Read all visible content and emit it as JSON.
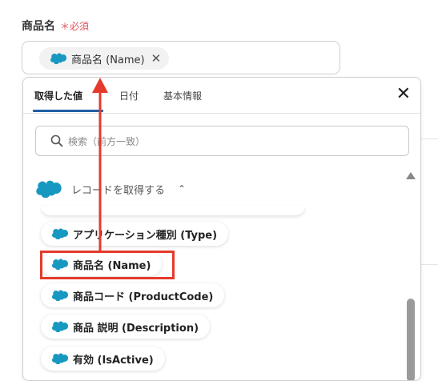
{
  "field": {
    "label": "商品名",
    "required": "＊必須",
    "chip_label": "商品名 (Name)",
    "chip_close": "✕"
  },
  "panel": {
    "tabs": [
      {
        "label": "取得した値",
        "active": true
      },
      {
        "label": "日付",
        "active": false
      },
      {
        "label": "基本情報",
        "active": false
      }
    ],
    "close": "✕",
    "search_placeholder": "検索（前方一致）",
    "section_title": "レコードを取得する",
    "section_chevron": "⌃",
    "items": [
      {
        "label": "アプリケーション種別 (Type)"
      },
      {
        "label": "商品名 (Name)",
        "highlighted": true
      },
      {
        "label": "商品コード (ProductCode)"
      },
      {
        "label": "商品 説明 (Description)"
      },
      {
        "label": "有効 (IsActive)"
      }
    ]
  },
  "colors": {
    "salesforce_blue": "#1798c1",
    "highlight_red": "#e53a2b",
    "tab_accent": "#1f5fa8",
    "required_red": "#e2505b"
  },
  "icons": [
    "salesforce-cloud-icon",
    "search-icon",
    "close-icon",
    "chevron-up-icon",
    "scroll-up-arrow-icon"
  ]
}
